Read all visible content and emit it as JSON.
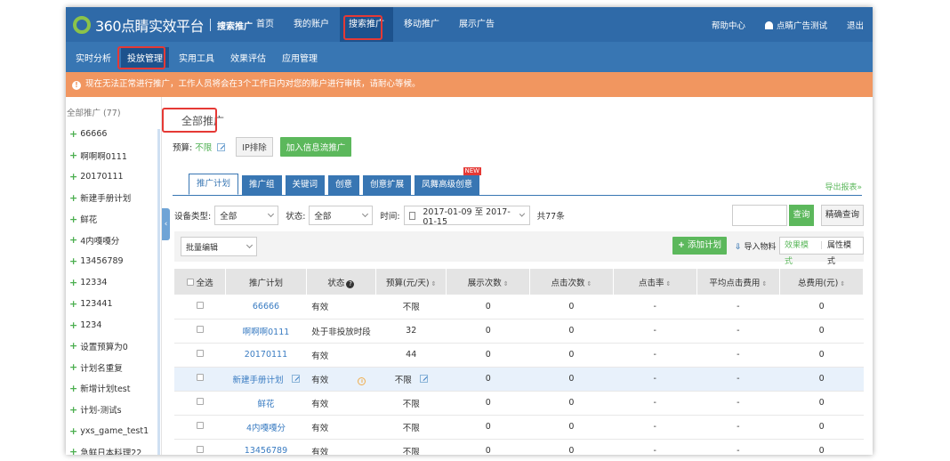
{
  "logo": {
    "brand": "360点睛实效平台",
    "sub": "搜索推广"
  },
  "topnav": [
    {
      "label": "首页"
    },
    {
      "label": "我的账户"
    },
    {
      "label": "搜索推广"
    },
    {
      "label": "移动推广"
    },
    {
      "label": "展示广告"
    }
  ],
  "topright": {
    "help": "帮助中心",
    "user": "点睛广告测试",
    "logout": "退出"
  },
  "subnav": [
    {
      "label": "实时分析"
    },
    {
      "label": "投放管理"
    },
    {
      "label": "实用工具"
    },
    {
      "label": "效果评估"
    },
    {
      "label": "应用管理"
    }
  ],
  "alert": {
    "icon": "!",
    "text": "现在无法正常进行推广，工作人员将会在3个工作日内对您的账户进行审核，请耐心等候。"
  },
  "sidebar": {
    "title": "全部推广 (77)",
    "items": [
      "66666",
      "啊啊啊0111",
      "20170111",
      "新建手册计划",
      "鲜花",
      "4内嘎嘎分",
      "13456789",
      "12334",
      "123441",
      "1234",
      "设置预算为0",
      "计划名重复",
      "新增计划test",
      "计划-测试s",
      "yxs_game_test1",
      "急鲜日本料理22"
    ]
  },
  "main": {
    "title": "全部推广",
    "budget_label": "预算:",
    "budget_value": "不限",
    "ip_button": "IP排除",
    "add_info_button": "加入信息流推广",
    "tabs": [
      "推广计划",
      "推广组",
      "关键词",
      "创意",
      "创意扩展",
      "凤舞高级创意"
    ],
    "new_badge": "NEW",
    "export": "导出报表»",
    "filter": {
      "device_label": "设备类型:",
      "device_value": "全部",
      "status_label": "状态:",
      "status_value": "全部",
      "time_label": "时间:",
      "date_range": "2017-01-09 至 2017-01-15",
      "total": "共77条",
      "query_button": "查询",
      "precise_button": "精确查询"
    },
    "toolbar": {
      "batch_edit": "批量编辑",
      "add_plan": "添加计划",
      "import": "导入物料",
      "mode_effect": "效果模式",
      "mode_attr": "属性模式"
    },
    "columns": [
      "全选",
      "推广计划",
      "状态",
      "预算(元/天)",
      "展示次数",
      "点击次数",
      "点击率",
      "平均点击费用",
      "总费用(元)"
    ],
    "rows": [
      {
        "plan": "66666",
        "status": "有效",
        "budget": "不限",
        "impressions": "0",
        "clicks": "0",
        "ctr": "-",
        "cpc": "-",
        "cost": "0"
      },
      {
        "plan": "啊啊啊0111",
        "status": "处于非投放时段",
        "budget": "32",
        "impressions": "0",
        "clicks": "0",
        "ctr": "-",
        "cpc": "-",
        "cost": "0"
      },
      {
        "plan": "20170111",
        "status": "有效",
        "budget": "44",
        "impressions": "0",
        "clicks": "0",
        "ctr": "-",
        "cpc": "-",
        "cost": "0"
      },
      {
        "plan": "新建手册计划",
        "status": "有效",
        "budget": "不限",
        "impressions": "0",
        "clicks": "0",
        "ctr": "-",
        "cpc": "-",
        "cost": "0"
      },
      {
        "plan": "鲜花",
        "status": "有效",
        "budget": "不限",
        "impressions": "0",
        "clicks": "0",
        "ctr": "-",
        "cpc": "-",
        "cost": "0"
      },
      {
        "plan": "4内嘎嘎分",
        "status": "有效",
        "budget": "不限",
        "impressions": "0",
        "clicks": "0",
        "ctr": "-",
        "cpc": "-",
        "cost": "0"
      },
      {
        "plan": "13456789",
        "status": "有效",
        "budget": "不限",
        "impressions": "0",
        "clicks": "0",
        "ctr": "-",
        "cpc": "-",
        "cost": "0"
      }
    ]
  },
  "colors": {
    "topbar": "#2f6aa8",
    "subbar": "#3876b3",
    "alert": "#f19660",
    "green": "#5cb85c",
    "highlight": "#e53935"
  }
}
